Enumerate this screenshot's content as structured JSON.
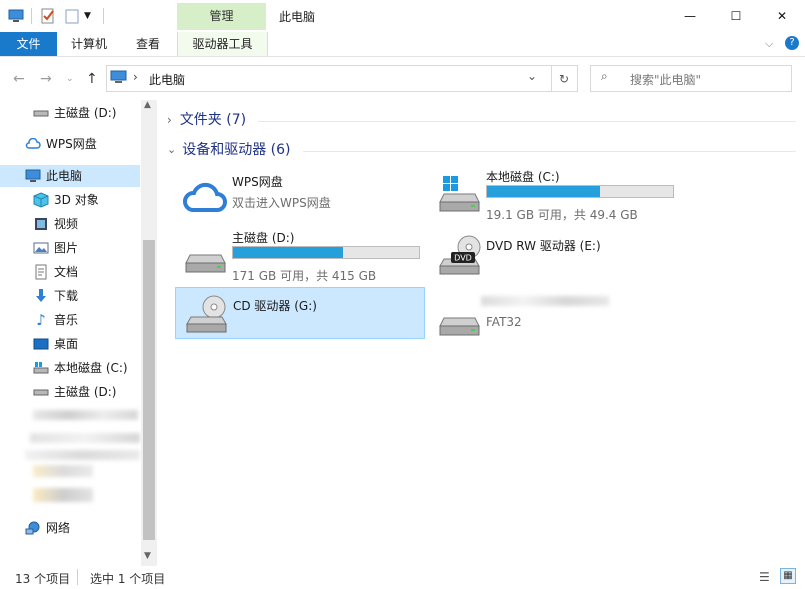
{
  "window": {
    "title": "此电脑",
    "context_tab_group": "管理",
    "controls": {
      "minimize": "—",
      "maximize": "☐",
      "close": "✕"
    }
  },
  "ribbon": {
    "tabs": [
      {
        "label": "文件",
        "active": true
      },
      {
        "label": "计算机"
      },
      {
        "label": "查看"
      },
      {
        "label": "驱动器工具"
      }
    ]
  },
  "address": {
    "path": "此电脑",
    "search_placeholder": "搜索\"此电脑\""
  },
  "sidebar": {
    "items": [
      {
        "label": "主磁盘 (D:)",
        "icon": "drive-icon"
      },
      {
        "label": "WPS网盘",
        "icon": "cloud-icon"
      },
      {
        "label": "此电脑",
        "icon": "computer-icon",
        "selected": true
      },
      {
        "label": "3D 对象",
        "icon": "cube-icon"
      },
      {
        "label": "视频",
        "icon": "video-icon"
      },
      {
        "label": "图片",
        "icon": "picture-icon"
      },
      {
        "label": "文档",
        "icon": "document-icon"
      },
      {
        "label": "下载",
        "icon": "download-icon"
      },
      {
        "label": "音乐",
        "icon": "music-icon"
      },
      {
        "label": "桌面",
        "icon": "desktop-icon"
      },
      {
        "label": "本地磁盘 (C:)",
        "icon": "windows-drive-icon"
      },
      {
        "label": "主磁盘 (D:)",
        "icon": "drive-icon"
      },
      {
        "label": "网络",
        "icon": "network-icon"
      }
    ]
  },
  "groups": {
    "folders": {
      "label": "文件夹 (7)",
      "expanded": false
    },
    "devices": {
      "label": "设备和驱动器 (6)",
      "expanded": true
    }
  },
  "drives": [
    {
      "name": "WPS网盘",
      "sub": "双击进入WPS网盘",
      "icon": "cloud-icon"
    },
    {
      "name": "本地磁盘 (C:)",
      "sub": "19.1 GB 可用，共 49.4 GB",
      "icon": "windows-drive-icon",
      "used_fraction": 0.61
    },
    {
      "name": "主磁盘 (D:)",
      "sub": "171 GB 可用，共 415 GB",
      "icon": "drive-icon",
      "used_fraction": 0.59
    },
    {
      "name": "DVD RW 驱动器 (E:)",
      "sub": "",
      "icon": "dvd-drive-icon"
    },
    {
      "name": "CD 驱动器 (G:)",
      "sub": "",
      "icon": "cd-drive-icon",
      "selected": true
    },
    {
      "name": "",
      "sub": "FAT32",
      "icon": "drive-icon"
    }
  ],
  "status": {
    "item_count": "13 个项目",
    "selection": "选中 1 个项目"
  },
  "colors": {
    "accent": "#1979ca",
    "selection": "#cce8ff",
    "bar_fill": "#26a0da",
    "tool_tab": "#d6efc9"
  }
}
